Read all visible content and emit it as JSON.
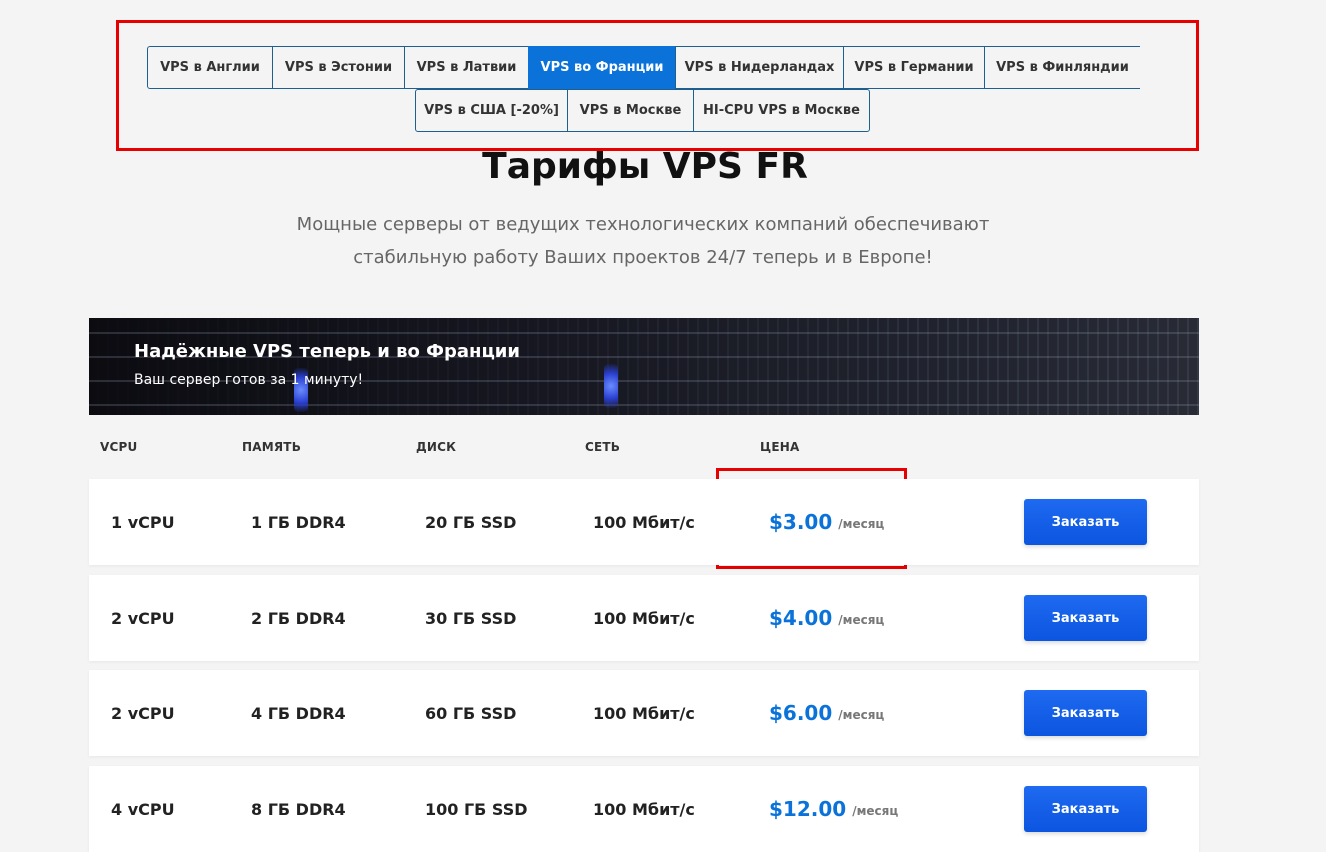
{
  "tabs": {
    "row1": [
      {
        "label": "VPS в Англии",
        "active": false
      },
      {
        "label": "VPS в Эстонии",
        "active": false
      },
      {
        "label": "VPS в Латвии",
        "active": false
      },
      {
        "label": "VPS во Франции",
        "active": true
      },
      {
        "label": "VPS в Нидерландах",
        "active": false
      },
      {
        "label": "VPS в Германии",
        "active": false
      },
      {
        "label": "VPS в Финляндии",
        "active": false
      }
    ],
    "row2": [
      {
        "label": "VPS в США [-20%]",
        "active": false
      },
      {
        "label": "VPS в Москве",
        "active": false
      },
      {
        "label": "HI-CPU VPS в Москве",
        "active": false
      }
    ]
  },
  "page": {
    "title": "Тарифы VPS FR",
    "subtitle_line1": "Мощные серверы от ведущих технологических компаний обеспечивают",
    "subtitle_line2": "стабильную работу Ваших проектов 24/7 теперь и в Европе!"
  },
  "banner": {
    "title": "Надёжные VPS теперь и во Франции",
    "subtitle": "Ваш сервер готов за 1 минуту!"
  },
  "table": {
    "headers": {
      "vcpu": "VCPU",
      "memory": "ПАМЯТЬ",
      "disk": "ДИСК",
      "network": "СЕТЬ",
      "price": "ЦЕНА"
    },
    "rows": [
      {
        "vcpu": "1 vCPU",
        "memory": "1 ГБ DDR4",
        "disk": "20 ГБ SSD",
        "network": "100 Мбит/с",
        "price": "$3.00",
        "per": "/месяц",
        "button": "Заказать"
      },
      {
        "vcpu": "2 vCPU",
        "memory": "2 ГБ DDR4",
        "disk": "30 ГБ SSD",
        "network": "100 Мбит/с",
        "price": "$4.00",
        "per": "/месяц",
        "button": "Заказать"
      },
      {
        "vcpu": "2 vCPU",
        "memory": "4 ГБ DDR4",
        "disk": "60 ГБ SSD",
        "network": "100 Мбит/с",
        "price": "$6.00",
        "per": "/месяц",
        "button": "Заказать"
      },
      {
        "vcpu": "4 vCPU",
        "memory": "8 ГБ DDR4",
        "disk": "100 ГБ SSD",
        "network": "100 Мбит/с",
        "price": "$12.00",
        "per": "/месяц",
        "button": "Заказать"
      }
    ]
  },
  "colors": {
    "accent": "#0a72d9",
    "highlight": "#e60000",
    "button": "#0c55e0"
  }
}
